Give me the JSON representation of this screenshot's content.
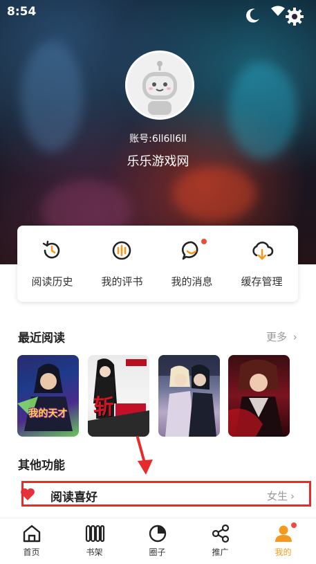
{
  "status": {
    "time": "8:54"
  },
  "profile": {
    "account": "账号:6ll6ll6ll",
    "username": "乐乐游戏网"
  },
  "quick_actions": [
    {
      "label": "阅读历史",
      "icon": "history-icon"
    },
    {
      "label": "我的评书",
      "icon": "comment-audio-icon"
    },
    {
      "label": "我的消息",
      "icon": "message-icon"
    },
    {
      "label": "缓存管理",
      "icon": "cloud-download-icon"
    }
  ],
  "recent": {
    "title": "最近阅读",
    "more": "更多",
    "books": [
      {
        "cover_title": "我的天才"
      },
      {
        "cover_title": "斩"
      },
      {
        "cover_title": ""
      },
      {
        "cover_title": ""
      }
    ]
  },
  "other": {
    "title": "其他功能",
    "preference": {
      "label": "阅读喜好",
      "value": "女生"
    }
  },
  "tabs": [
    {
      "label": "首页",
      "active": false
    },
    {
      "label": "书架",
      "active": false
    },
    {
      "label": "圈子",
      "active": false
    },
    {
      "label": "推广",
      "active": false
    },
    {
      "label": "我的",
      "active": true
    }
  ],
  "colors": {
    "accent": "#f39a1e",
    "badge": "#f04a3a",
    "highlight": "#e52b2b"
  }
}
